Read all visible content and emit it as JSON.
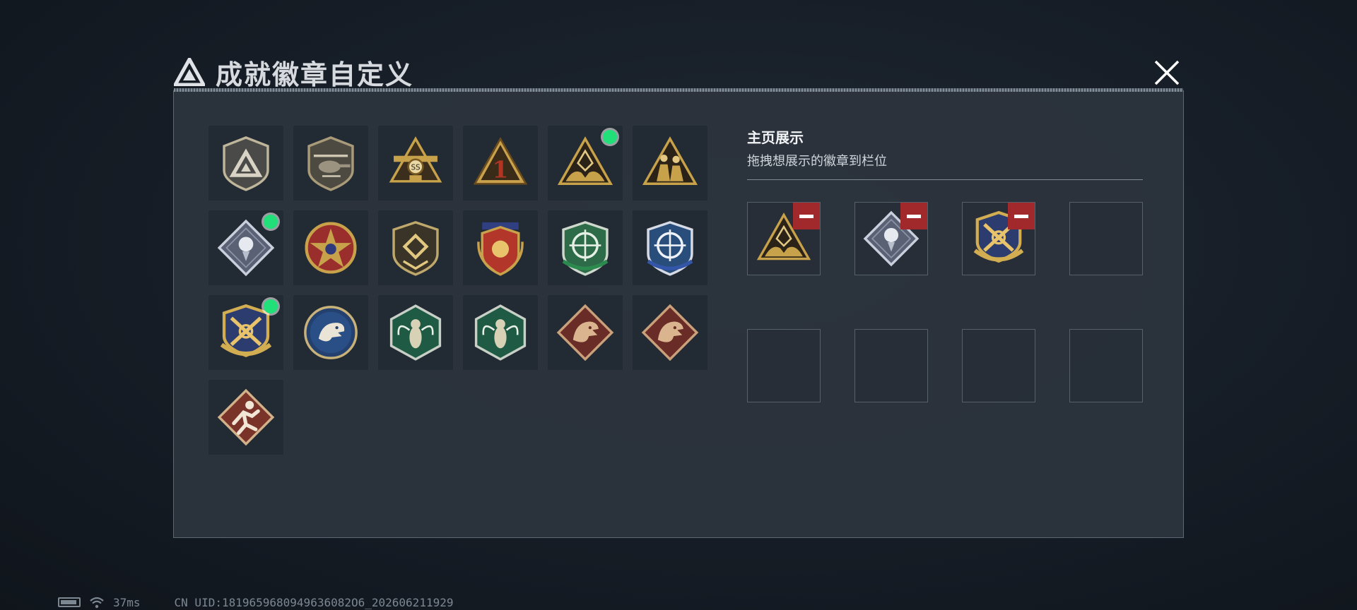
{
  "header": {
    "title": "成就徽章自定义",
    "logo_icon": "triangle-logo-icon",
    "close_icon": "close-icon"
  },
  "badges": [
    {
      "icon": "triangle-shield-badge-icon",
      "new": false
    },
    {
      "icon": "helicopter-badge-icon",
      "new": false
    },
    {
      "icon": "ss-rank-badge-icon",
      "new": false
    },
    {
      "icon": "number-one-triangle-badge-icon",
      "new": false
    },
    {
      "icon": "hands-triangle-badge-icon",
      "new": true
    },
    {
      "icon": "soldiers-triangle-badge-icon",
      "new": false
    },
    {
      "icon": "silver-rose-diamond-badge-icon",
      "new": true
    },
    {
      "icon": "star-compass-badge-icon",
      "new": false
    },
    {
      "icon": "chevron-shield-badge-icon",
      "new": false
    },
    {
      "icon": "laurel-shield-badge-icon",
      "new": false
    },
    {
      "icon": "green-rifle-crosshair-badge-icon",
      "new": false
    },
    {
      "icon": "blue-rifle-crosshair-badge-icon",
      "new": false
    },
    {
      "icon": "gold-crossed-rifles-badge-icon",
      "new": true
    },
    {
      "icon": "eagle-medallion-badge-icon",
      "new": false
    },
    {
      "icon": "hornet-hexagon-badge-icon",
      "new": false
    },
    {
      "icon": "hornet-hexagon-badge-icon",
      "new": false
    },
    {
      "icon": "dragon-diamond-badge-icon",
      "new": false
    },
    {
      "icon": "dragon-diamond-badge-icon",
      "new": false
    },
    {
      "icon": "runner-diamond-badge-icon",
      "new": false
    }
  ],
  "display": {
    "heading": "主页展示",
    "subtitle": "拖拽想展示的徽章到栏位",
    "slots": [
      {
        "icon": "hands-triangle-badge-icon",
        "filled": true
      },
      {
        "icon": "silver-rose-diamond-badge-icon",
        "filled": true
      },
      {
        "icon": "gold-crossed-rifles-badge-icon",
        "filled": true
      },
      {
        "icon": "",
        "filled": false
      },
      {
        "icon": "",
        "filled": false
      },
      {
        "icon": "",
        "filled": false
      },
      {
        "icon": "",
        "filled": false
      },
      {
        "icon": "",
        "filled": false
      }
    ],
    "remove_icon": "minus-icon"
  },
  "status": {
    "latency": "37ms",
    "uid": "CN UID:1819659680949636082O6_202606211929"
  },
  "colors": {
    "accent_new": "#21e07a",
    "remove": "#a1282b",
    "gold": "#c8a24a"
  }
}
